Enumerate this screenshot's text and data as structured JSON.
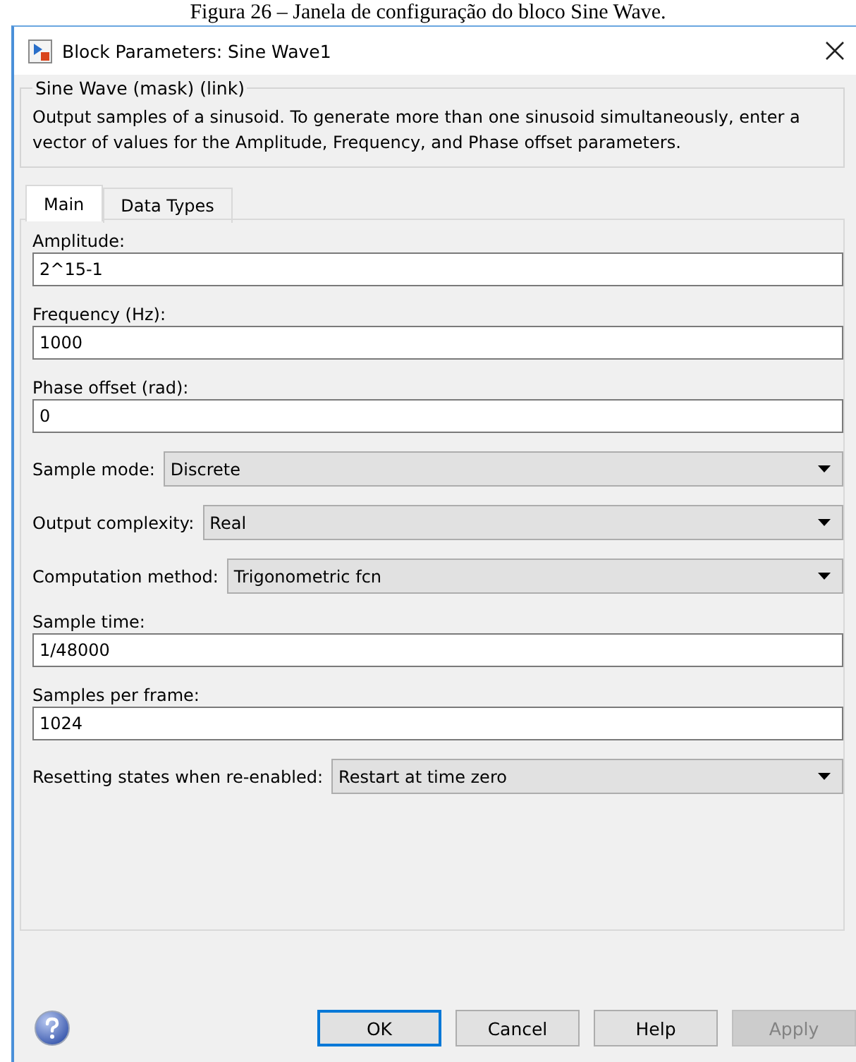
{
  "caption": "Figura 26 – Janela de configuração do bloco Sine Wave.",
  "window": {
    "title": "Block Parameters: Sine Wave1"
  },
  "group": {
    "title": "Sine Wave (mask) (link)",
    "description": "Output samples of a sinusoid.  To generate more than one sinusoid simultaneously, enter a vector of values for the Amplitude, Frequency, and Phase offset parameters."
  },
  "tabs": [
    {
      "label": "Main",
      "selected": true
    },
    {
      "label": "Data Types",
      "selected": false
    }
  ],
  "parameters": [
    {
      "kind": "text",
      "label": "Amplitude:",
      "value": "2^15-1"
    },
    {
      "kind": "text",
      "label": "Frequency (Hz):",
      "value": "1000"
    },
    {
      "kind": "text",
      "label": "Phase offset (rad):",
      "value": "0"
    },
    {
      "kind": "dropdown",
      "label": "Sample mode:",
      "value": "Discrete"
    },
    {
      "kind": "dropdown",
      "label": "Output complexity:",
      "value": "Real"
    },
    {
      "kind": "dropdown",
      "label": "Computation method:",
      "value": "Trigonometric fcn"
    },
    {
      "kind": "text",
      "label": "Sample time:",
      "value": "1/48000"
    },
    {
      "kind": "text",
      "label": "Samples per frame:",
      "value": "1024"
    },
    {
      "kind": "dropdown",
      "label": "Resetting states when re-enabled:",
      "value": "Restart at time zero"
    }
  ],
  "buttons": [
    {
      "label": "OK",
      "default": true,
      "disabled": false
    },
    {
      "label": "Cancel",
      "default": false,
      "disabled": false
    },
    {
      "label": "Help",
      "default": false,
      "disabled": false
    },
    {
      "label": "Apply",
      "default": false,
      "disabled": true
    }
  ]
}
